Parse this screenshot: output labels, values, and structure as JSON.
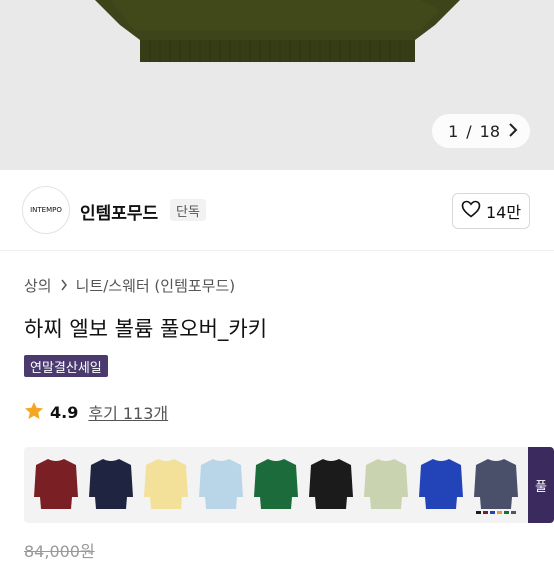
{
  "gallery": {
    "current": "1",
    "total": "18",
    "separator": "/",
    "next_icon": "chevron-right-icon",
    "bg_color": "#e9e9e9",
    "garment_color": "#3d4419"
  },
  "brand": {
    "logo_text": "INTEMPO",
    "name": "인템포무드",
    "tag": "단독"
  },
  "like": {
    "icon": "heart-outline-icon",
    "count": "14만"
  },
  "breadcrumb": {
    "items": [
      "상의",
      "니트/스웨터 (인템포무드)"
    ],
    "separator": ">"
  },
  "product": {
    "title": "하찌 엘보 볼륨 풀오버_카키",
    "badge": "연말결산세일",
    "badge_color": "#4a3a6e",
    "rating": "4.9",
    "reviews": "후기 113개",
    "original_price": "84,000원"
  },
  "color_options": [
    {
      "name": "burgundy",
      "color": "#7a1f24"
    },
    {
      "name": "navy",
      "color": "#1f2440"
    },
    {
      "name": "butter",
      "color": "#f3e19a"
    },
    {
      "name": "sky",
      "color": "#b9d5e8"
    },
    {
      "name": "green",
      "color": "#1c6b3a"
    },
    {
      "name": "black",
      "color": "#1b1b1b"
    },
    {
      "name": "sage",
      "color": "#c9d3b0"
    },
    {
      "name": "blue",
      "color": "#2344b8"
    },
    {
      "name": "multi",
      "color": "#4a4f6a"
    }
  ],
  "more_thumb": {
    "label": "풀",
    "color": "#3a2a5e"
  }
}
